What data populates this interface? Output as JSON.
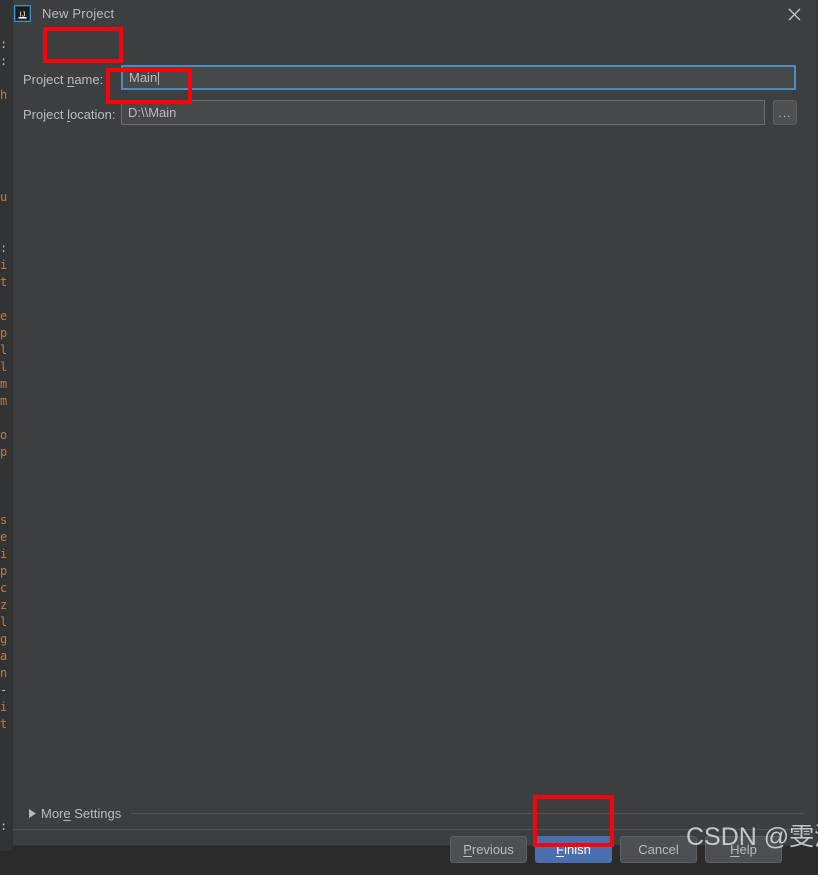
{
  "window": {
    "title": "New Project",
    "app_icon": "intellij-idea-icon",
    "close_icon": "close-icon"
  },
  "form": {
    "name_field": {
      "label_before": "Project ",
      "label_mnemonic": "n",
      "label_after": "ame:",
      "label_full": "Project name:",
      "value": "Main",
      "focused": true
    },
    "location_field": {
      "label_before": "Project ",
      "label_mnemonic": "l",
      "label_after": "ocation:",
      "label_full": "Project location:",
      "value": "D:\\\\Main",
      "browse_button_label": "...",
      "browse_icon": "ellipsis-icon"
    }
  },
  "more_settings": {
    "label_before": "Mor",
    "label_mnemonic": "e",
    "label_after": " Settings",
    "label_full": "More Settings",
    "expanded": false,
    "expander_icon": "triangle-right-icon"
  },
  "buttons": [
    {
      "name": "previous",
      "before": "",
      "mnemonic": "P",
      "after": "revious",
      "full": "Previous",
      "primary": false
    },
    {
      "name": "finish",
      "before": "",
      "mnemonic": "F",
      "after": "inish",
      "full": "Finish",
      "primary": true
    },
    {
      "name": "cancel",
      "before": "Cancel",
      "mnemonic": "",
      "after": "",
      "full": "Cancel",
      "primary": false
    },
    {
      "name": "help",
      "before": "",
      "mnemonic": "H",
      "after": "elp",
      "full": "Help",
      "primary": false
    }
  ],
  "annotations": [
    {
      "name": "project-name-highlight",
      "target": "name-input"
    },
    {
      "name": "project-location-highlight",
      "target": "location-input"
    },
    {
      "name": "finish-button-highlight",
      "target": "btn-finish"
    }
  ],
  "watermark": "CSDN @雯浅",
  "backdrop_code_chars": [
    "",
    "",
    ":",
    ":",
    "",
    "h",
    "",
    "",
    "",
    "",
    "",
    "u",
    "",
    "",
    ":",
    "i",
    "t",
    "",
    "e",
    "p",
    "l",
    "l",
    "m",
    "m",
    "",
    "o",
    "p",
    "",
    "",
    "",
    "s",
    "e",
    "i",
    "p",
    "c",
    "z",
    "l",
    "g",
    "a",
    "n",
    "-",
    "i",
    "t",
    "",
    "",
    "",
    "",
    "",
    ":"
  ],
  "colors": {
    "dialog_bg": "#3c3f41",
    "input_bg": "#45494a",
    "text": "#bbbbbb",
    "focus_border": "#4b8bbd",
    "primary_button": "#4b6eaf",
    "annotation_red": "#fb0007",
    "editor_bg": "#2b2b2b",
    "code_orange": "#cc7832"
  }
}
